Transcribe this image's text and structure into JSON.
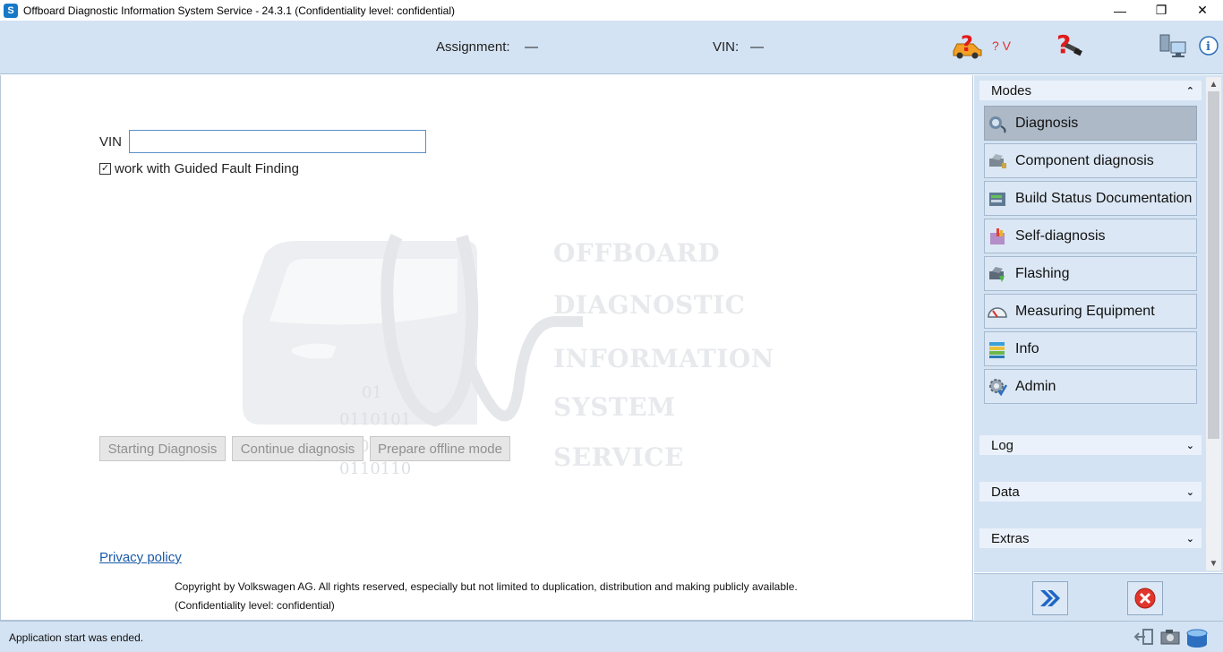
{
  "window": {
    "title": "Offboard Diagnostic Information System Service - 24.3.1 (Confidentiality level: confidential)",
    "app_icon_letter": "S",
    "minimize_glyph": "—",
    "maximize_glyph": "❐",
    "close_glyph": "✕"
  },
  "header": {
    "assignment_label": "Assignment:",
    "assignment_value": "—",
    "vin_label": "VIN:",
    "vin_value": "—",
    "voltage_text": "? V"
  },
  "main": {
    "vin_label": "VIN",
    "vin_value": "",
    "gff_checked": true,
    "gff_checkmark": "✓",
    "gff_label": "work with Guided Fault Finding",
    "watermark": {
      "binary_lines": [
        "01",
        "0110101",
        "01101",
        "0110110"
      ],
      "words": [
        "OFFBOARD",
        "DIAGNOSTIC",
        "INFORMATION",
        "SYSTEM",
        "SERVICE"
      ]
    },
    "buttons": {
      "start": "Starting Diagnosis",
      "continue": "Continue diagnosis",
      "offline": "Prepare offline mode"
    },
    "privacy_link": "Privacy policy",
    "copyright": "Copyright by Volkswagen AG. All rights reserved, especially but not limited to duplication, distribution and making publicly available.",
    "confidentiality": "(Confidentiality level: confidential)"
  },
  "sidebar": {
    "modes_header": "Modes",
    "modes": [
      {
        "label": "Diagnosis",
        "icon": "stethoscope-icon",
        "active": true
      },
      {
        "label": "Component diagnosis",
        "icon": "component-icon",
        "active": false
      },
      {
        "label": "Build Status Documentation",
        "icon": "build-status-icon",
        "active": false
      },
      {
        "label": "Self-diagnosis",
        "icon": "self-diagnosis-icon",
        "active": false
      },
      {
        "label": "Flashing",
        "icon": "flashing-icon",
        "active": false
      },
      {
        "label": "Measuring Equipment",
        "icon": "gauge-icon",
        "active": false
      },
      {
        "label": "Info",
        "icon": "books-icon",
        "active": false
      },
      {
        "label": "Admin",
        "icon": "gear-icon",
        "active": false
      }
    ],
    "log_header": "Log",
    "data_header": "Data",
    "extras_header": "Extras",
    "collapse_glyph": "⌃",
    "expand_glyph": "⌄"
  },
  "status": {
    "text": "Application start was ended."
  },
  "colors": {
    "panel_bg": "#d4e3f3",
    "accent": "#1679c8",
    "danger": "#e03030"
  }
}
